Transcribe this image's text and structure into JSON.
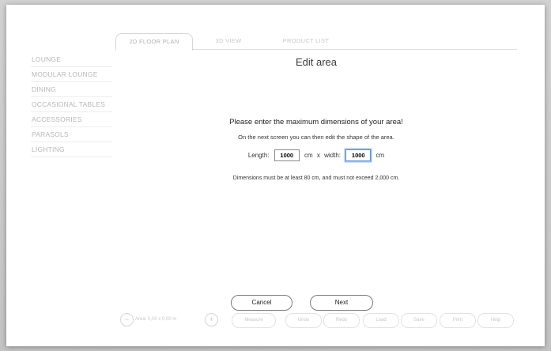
{
  "sidebar": {
    "items": [
      {
        "label": "LOUNGE"
      },
      {
        "label": "MODULAR LOUNGE"
      },
      {
        "label": "DINING"
      },
      {
        "label": "OCCASIONAL TABLES"
      },
      {
        "label": "ACCESSORIES"
      },
      {
        "label": "PARASOLS"
      },
      {
        "label": "LIGHTING"
      }
    ]
  },
  "tabs": [
    {
      "label": "2D FLOOR PLAN",
      "active": true
    },
    {
      "label": "3D VIEW",
      "active": false
    },
    {
      "label": "PRODUCT LIST",
      "active": false
    }
  ],
  "dialog": {
    "title": "Edit area",
    "heading": "Please enter the maximum dimensions of your area!",
    "subtext": "On the next screen you can then edit the shape of the area.",
    "length_label": "Length:",
    "length_value": "1000",
    "length_unit": "cm",
    "separator": "x",
    "width_label": "width:",
    "width_value": "1000",
    "width_unit": "cm",
    "note": "Dimensions must be at least 80 cm, and must not exceed 2,000 cm.",
    "cancel_label": "Cancel",
    "next_label": "Next"
  },
  "toolbar": {
    "zoom_out_symbol": "−",
    "area_text": "Area: 0,00 x 0,00 m",
    "zoom_in_symbol": "+",
    "measure_label": "Measure",
    "undo_label": "Undo",
    "redo_label": "Redo",
    "load_label": "Load",
    "save_label": "Save",
    "print_label": "Print",
    "help_label": "Help"
  },
  "colors": {
    "focus_ring": "#5a8ed8",
    "muted_text": "#b8b8b8",
    "dialog_text": "#222222"
  }
}
